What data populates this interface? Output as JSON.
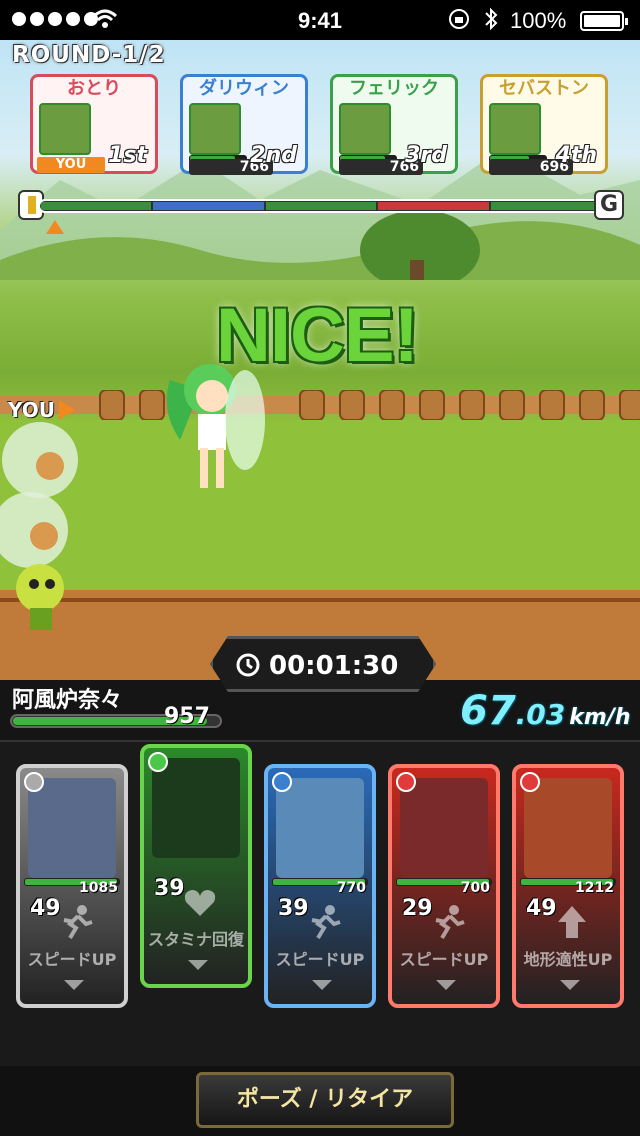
{
  "status_bar": {
    "time": "9:41",
    "battery": "100%"
  },
  "round": "ROUND-1/2",
  "players": [
    {
      "name": "おとり",
      "you_tag": "YOU",
      "rank": "1st",
      "color": "#d94a5a",
      "bg": "#fff3f3",
      "score": "",
      "stamina": 1.0
    },
    {
      "name": "ダリウィン",
      "rank": "2nd",
      "color": "#3a80d0",
      "bg": "#eef5ff",
      "score": "766",
      "stamina": 0.8
    },
    {
      "name": "フェリック",
      "rank": "3rd",
      "color": "#3aa04a",
      "bg": "#f0fbef",
      "score": "766",
      "stamina": 0.8
    },
    {
      "name": "セバストン",
      "rank": "4th",
      "color": "#c8a030",
      "bg": "#fffbe8",
      "score": "696",
      "stamina": 0.7
    }
  ],
  "track": {
    "progress": 0.03,
    "segments": [
      {
        "color": "#3a8f3a",
        "length": 0.2
      },
      {
        "color": "#3a70c8",
        "length": 0.2
      },
      {
        "color": "#3a8f3a",
        "length": 0.2
      },
      {
        "color": "#c83a3a",
        "length": 0.2
      },
      {
        "color": "#3a8f3a",
        "length": 0.2
      }
    ],
    "goal_label": "G"
  },
  "banner": "NICE!",
  "you_indicator": "YOU",
  "racer_name": "阿風炉奈々",
  "stamina_value": "957",
  "stamina_ratio": 0.95,
  "timer": "00:01:30",
  "speed": {
    "whole": "67",
    "decimal": ".03",
    "unit": "km/h"
  },
  "cards": [
    {
      "theme": "silver",
      "border": "#d0d0d0",
      "bg": "#8a8a8a",
      "art": "#5a6a8a",
      "hp": "1085",
      "cost": "49",
      "skill": "スピードUP",
      "orb": "#aaaaaa",
      "icon": "run-icon",
      "empty": false
    },
    {
      "theme": "green",
      "border": "#6ad44a",
      "bg": "#2a8a2a",
      "art": "#1c3a1c",
      "hp": "",
      "cost": "39",
      "skill": "スタミナ回復",
      "orb": "#4ac84a",
      "icon": "heart-icon",
      "empty": true
    },
    {
      "theme": "blue",
      "border": "#6ab4f4",
      "bg": "#2a6ab8",
      "art": "#5a8ab8",
      "hp": "770",
      "cost": "39",
      "skill": "スピードUP",
      "orb": "#3a80d0",
      "icon": "run-icon",
      "empty": false
    },
    {
      "theme": "red",
      "border": "#ff7a6a",
      "bg": "#c8281e",
      "art": "#7a2a2a",
      "hp": "700",
      "cost": "29",
      "skill": "スピードUP",
      "orb": "#e03a3a",
      "icon": "run-icon",
      "empty": false
    },
    {
      "theme": "red",
      "border": "#ff7a6a",
      "bg": "#c8281e",
      "art": "#a84a2a",
      "hp": "1212",
      "cost": "49",
      "skill": "地形適性UP",
      "orb": "#e03a3a",
      "icon": "arrow-up-icon",
      "empty": false
    }
  ],
  "pause_button": "ポーズ / リタイア"
}
